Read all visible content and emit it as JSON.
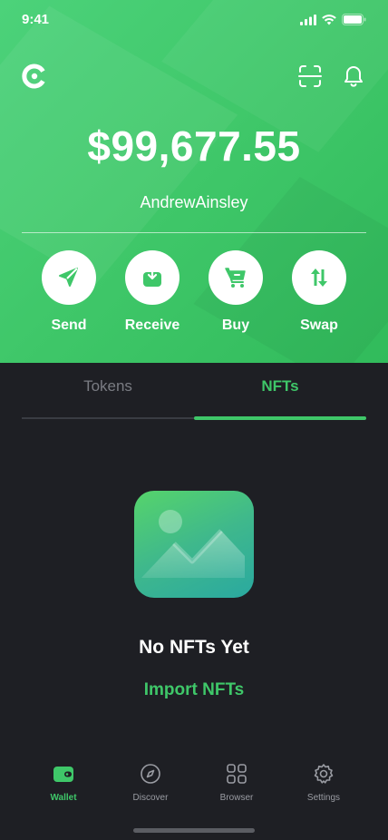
{
  "status_bar": {
    "time": "9:41"
  },
  "header": {
    "balance": "$99,677.55",
    "username": "AndrewAinsley"
  },
  "actions": [
    {
      "label": "Send",
      "icon": "send-icon"
    },
    {
      "label": "Receive",
      "icon": "receive-icon"
    },
    {
      "label": "Buy",
      "icon": "cart-icon"
    },
    {
      "label": "Swap",
      "icon": "swap-icon"
    }
  ],
  "tabs": [
    {
      "label": "Tokens",
      "active": false
    },
    {
      "label": "NFTs",
      "active": true
    }
  ],
  "empty_state": {
    "title": "No NFTs Yet",
    "action": "Import NFTs"
  },
  "bottom_nav": [
    {
      "label": "Wallet",
      "icon": "wallet-icon",
      "active": true
    },
    {
      "label": "Discover",
      "icon": "compass-icon",
      "active": false
    },
    {
      "label": "Browser",
      "icon": "grid-icon",
      "active": false
    },
    {
      "label": "Settings",
      "icon": "gear-icon",
      "active": false
    }
  ],
  "colors": {
    "accent": "#3fc769",
    "background": "#1e1f24"
  }
}
